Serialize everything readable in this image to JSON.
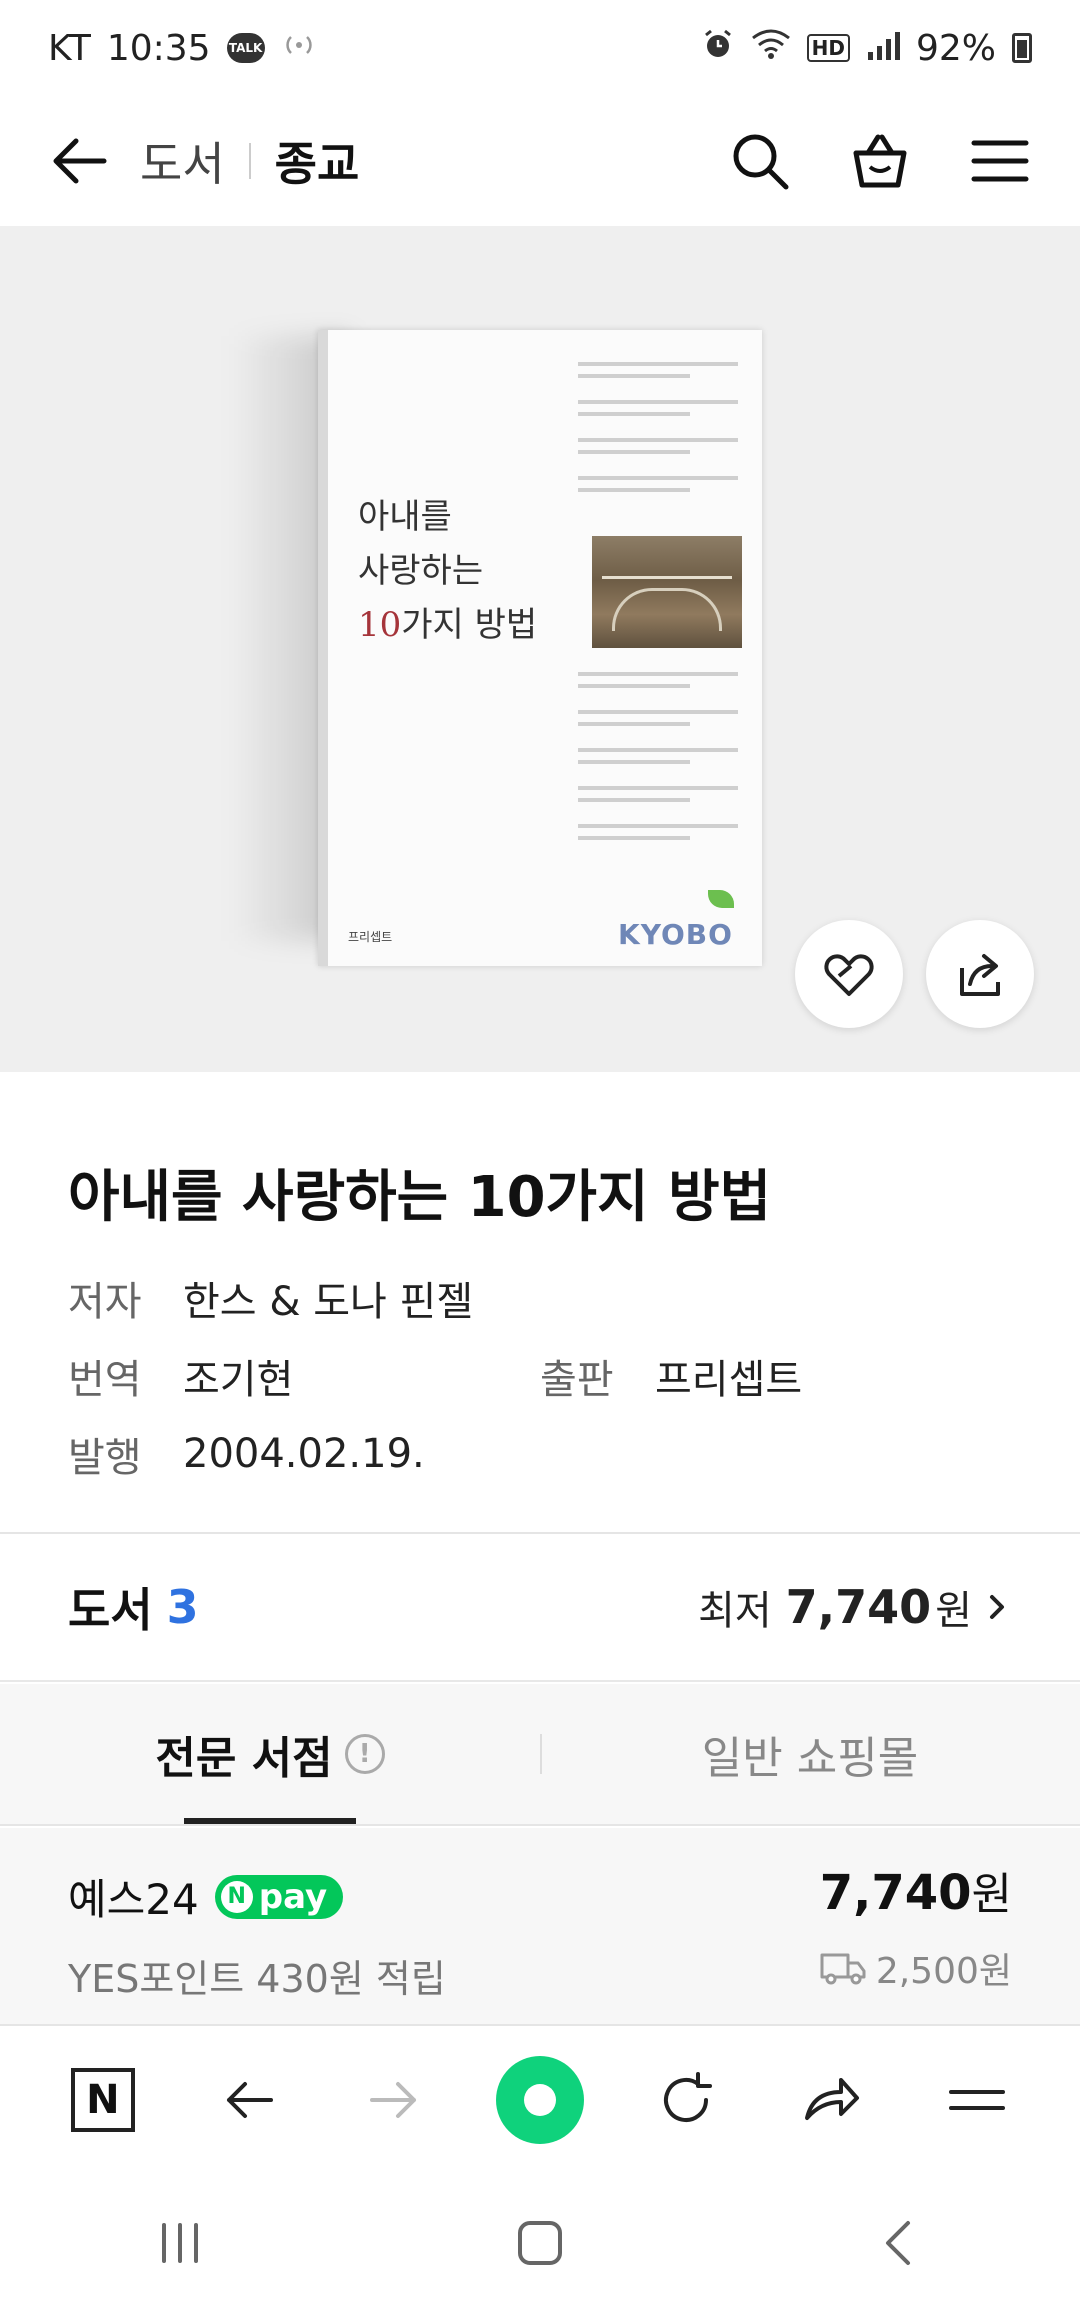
{
  "status_bar": {
    "carrier": "KT",
    "time": "10:35",
    "talk_badge": "TALK",
    "hd_label": "HD",
    "battery": "92%"
  },
  "header": {
    "breadcrumb_parent": "도서",
    "breadcrumb_current": "종교"
  },
  "book_cover": {
    "cover_title_line1": "아내를",
    "cover_title_line2": "사랑하는",
    "cover_title_num": "10",
    "cover_title_line3": "가지 방법",
    "cover_publisher": "프리셉트",
    "cover_logo": "KYOBO"
  },
  "product": {
    "title": "아내를 사랑하는 10가지 방법",
    "author_label": "저자",
    "author": "한스 & 도나 핀젤",
    "translator_label": "번역",
    "translator": "조기현",
    "publisher_label": "출판",
    "publisher": "프리셉트",
    "date_label": "발행",
    "date": "2004.02.19."
  },
  "offers": {
    "label": "도서",
    "count": "3",
    "lowest_label": "최저",
    "lowest_price": "7,740",
    "currency": "원"
  },
  "tabs": [
    {
      "label": "전문 서점",
      "active": true
    },
    {
      "label": "일반 쇼핑몰",
      "active": false
    }
  ],
  "seller": {
    "name": "예스24",
    "npay_label": "pay",
    "npay_n": "N",
    "points": "YES포인트 430원 적립",
    "price": "7,740",
    "currency": "원",
    "shipping": "2,500원"
  },
  "colors": {
    "accent_blue": "#2f72e0",
    "npay_green": "#03c75a",
    "naver_green": "#0fd27c"
  }
}
